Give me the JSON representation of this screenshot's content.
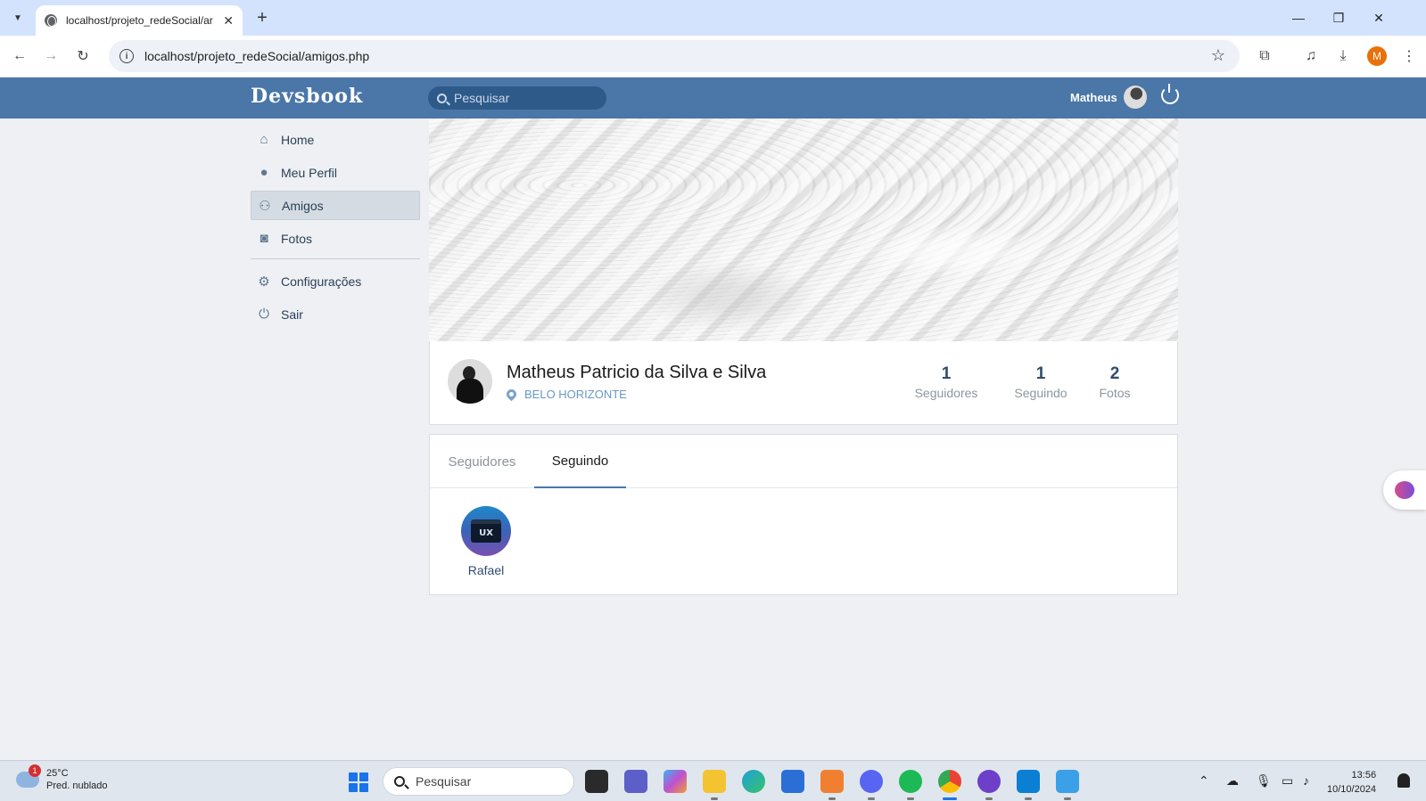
{
  "browser": {
    "tab_title": "localhost/projeto_redeSocial/ar",
    "url": "localhost/projeto_redeSocial/amigos.php",
    "profile_initial": "M"
  },
  "header": {
    "logo": "Devsbook",
    "search_placeholder": "Pesquisar",
    "user_name": "Matheus"
  },
  "sidebar": {
    "items": [
      {
        "label": "Home",
        "icon": "home-icon"
      },
      {
        "label": "Meu Perfil",
        "icon": "user-icon"
      },
      {
        "label": "Amigos",
        "icon": "friends-icon",
        "active": true
      },
      {
        "label": "Fotos",
        "icon": "camera-icon"
      },
      {
        "label": "Configurações",
        "icon": "gear-icon"
      },
      {
        "label": "Sair",
        "icon": "power-icon"
      }
    ]
  },
  "profile": {
    "name": "Matheus Patricio da Silva e Silva",
    "location": "BELO HORIZONTE",
    "stats": [
      {
        "value": "1",
        "label": "Seguidores"
      },
      {
        "value": "1",
        "label": "Seguindo"
      },
      {
        "value": "2",
        "label": "Fotos"
      }
    ]
  },
  "friends": {
    "tabs": [
      {
        "label": "Seguidores",
        "active": false
      },
      {
        "label": "Seguindo",
        "active": true
      }
    ],
    "list": [
      {
        "name": "Rafael",
        "avatar_text": "UX"
      }
    ]
  },
  "taskbar": {
    "weather_temp": "25°C",
    "weather_desc": "Pred. nublado",
    "weather_badge": "1",
    "search_label": "Pesquisar",
    "time": "13:56",
    "date": "10/10/2024"
  },
  "colors": {
    "header_bg": "#4a76a8",
    "page_bg": "#eef0f3",
    "accent": "#4a76a8"
  }
}
